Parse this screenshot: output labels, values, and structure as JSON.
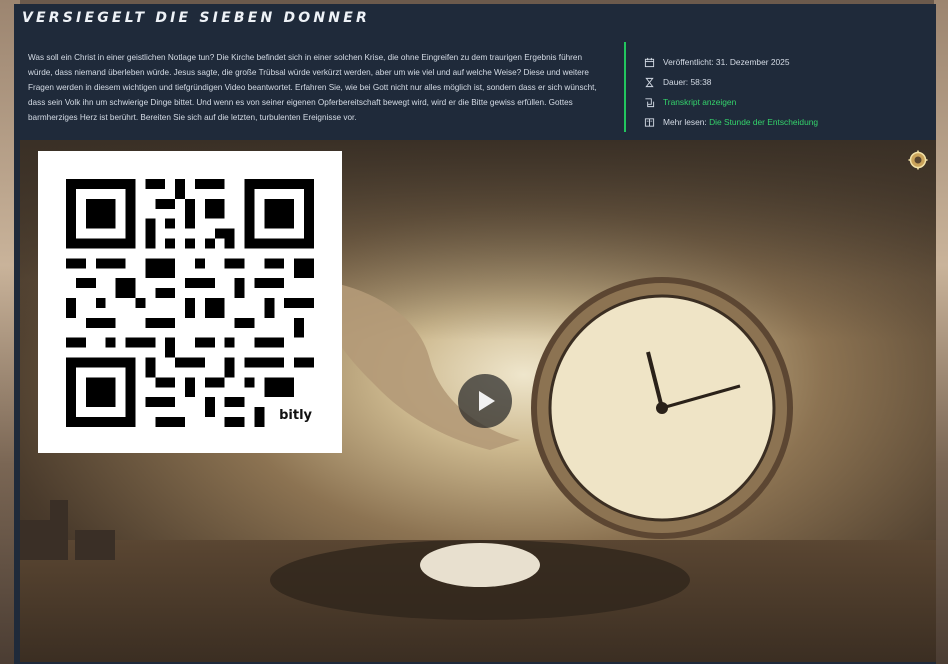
{
  "header": {
    "title": "VERSIEGELT DIE SIEBEN DONNER"
  },
  "description": "Was soll ein Christ in einer geistlichen Notlage tun? Die Kirche befindet sich in einer solchen Krise, die ohne Eingreifen zu dem traurigen Ergebnis führen würde, dass niemand überleben würde. Jesus sagte, die große Trübsal würde verkürzt werden, aber um wie viel und auf welche Weise? Diese und weitere Fragen werden in diesem wichtigen und tiefgründigen Video beantwortet. Erfahren Sie, wie bei Gott nicht nur alles möglich ist, sondern dass er sich wünscht, dass sein Volk ihn um schwierige Dinge bittet. Und wenn es von seiner eigenen Opferbereitschaft bewegt wird, wird er die Bitte gewiss erfüllen. Gottes barmherziges Herz ist berührt. Bereiten Sie sich auf die letzten, turbulenten Ereignisse vor.",
  "meta": {
    "published": "Veröffentlicht: 31. Dezember 2025",
    "duration": "Dauer: 58:38",
    "transcript": "Transkript anzeigen",
    "more_label": "Mehr lesen:",
    "more_link": "Die Stunde der Entscheidung"
  },
  "qr": {
    "brand": "bitly"
  },
  "icons": {
    "calendar": "calendar-icon",
    "duration": "hourglass-icon",
    "transcript": "transcript-icon",
    "more": "book-icon",
    "play": "play-icon",
    "settings": "gear-icon"
  },
  "colors": {
    "panel": "#1f2a3a",
    "accent": "#34d36b"
  }
}
